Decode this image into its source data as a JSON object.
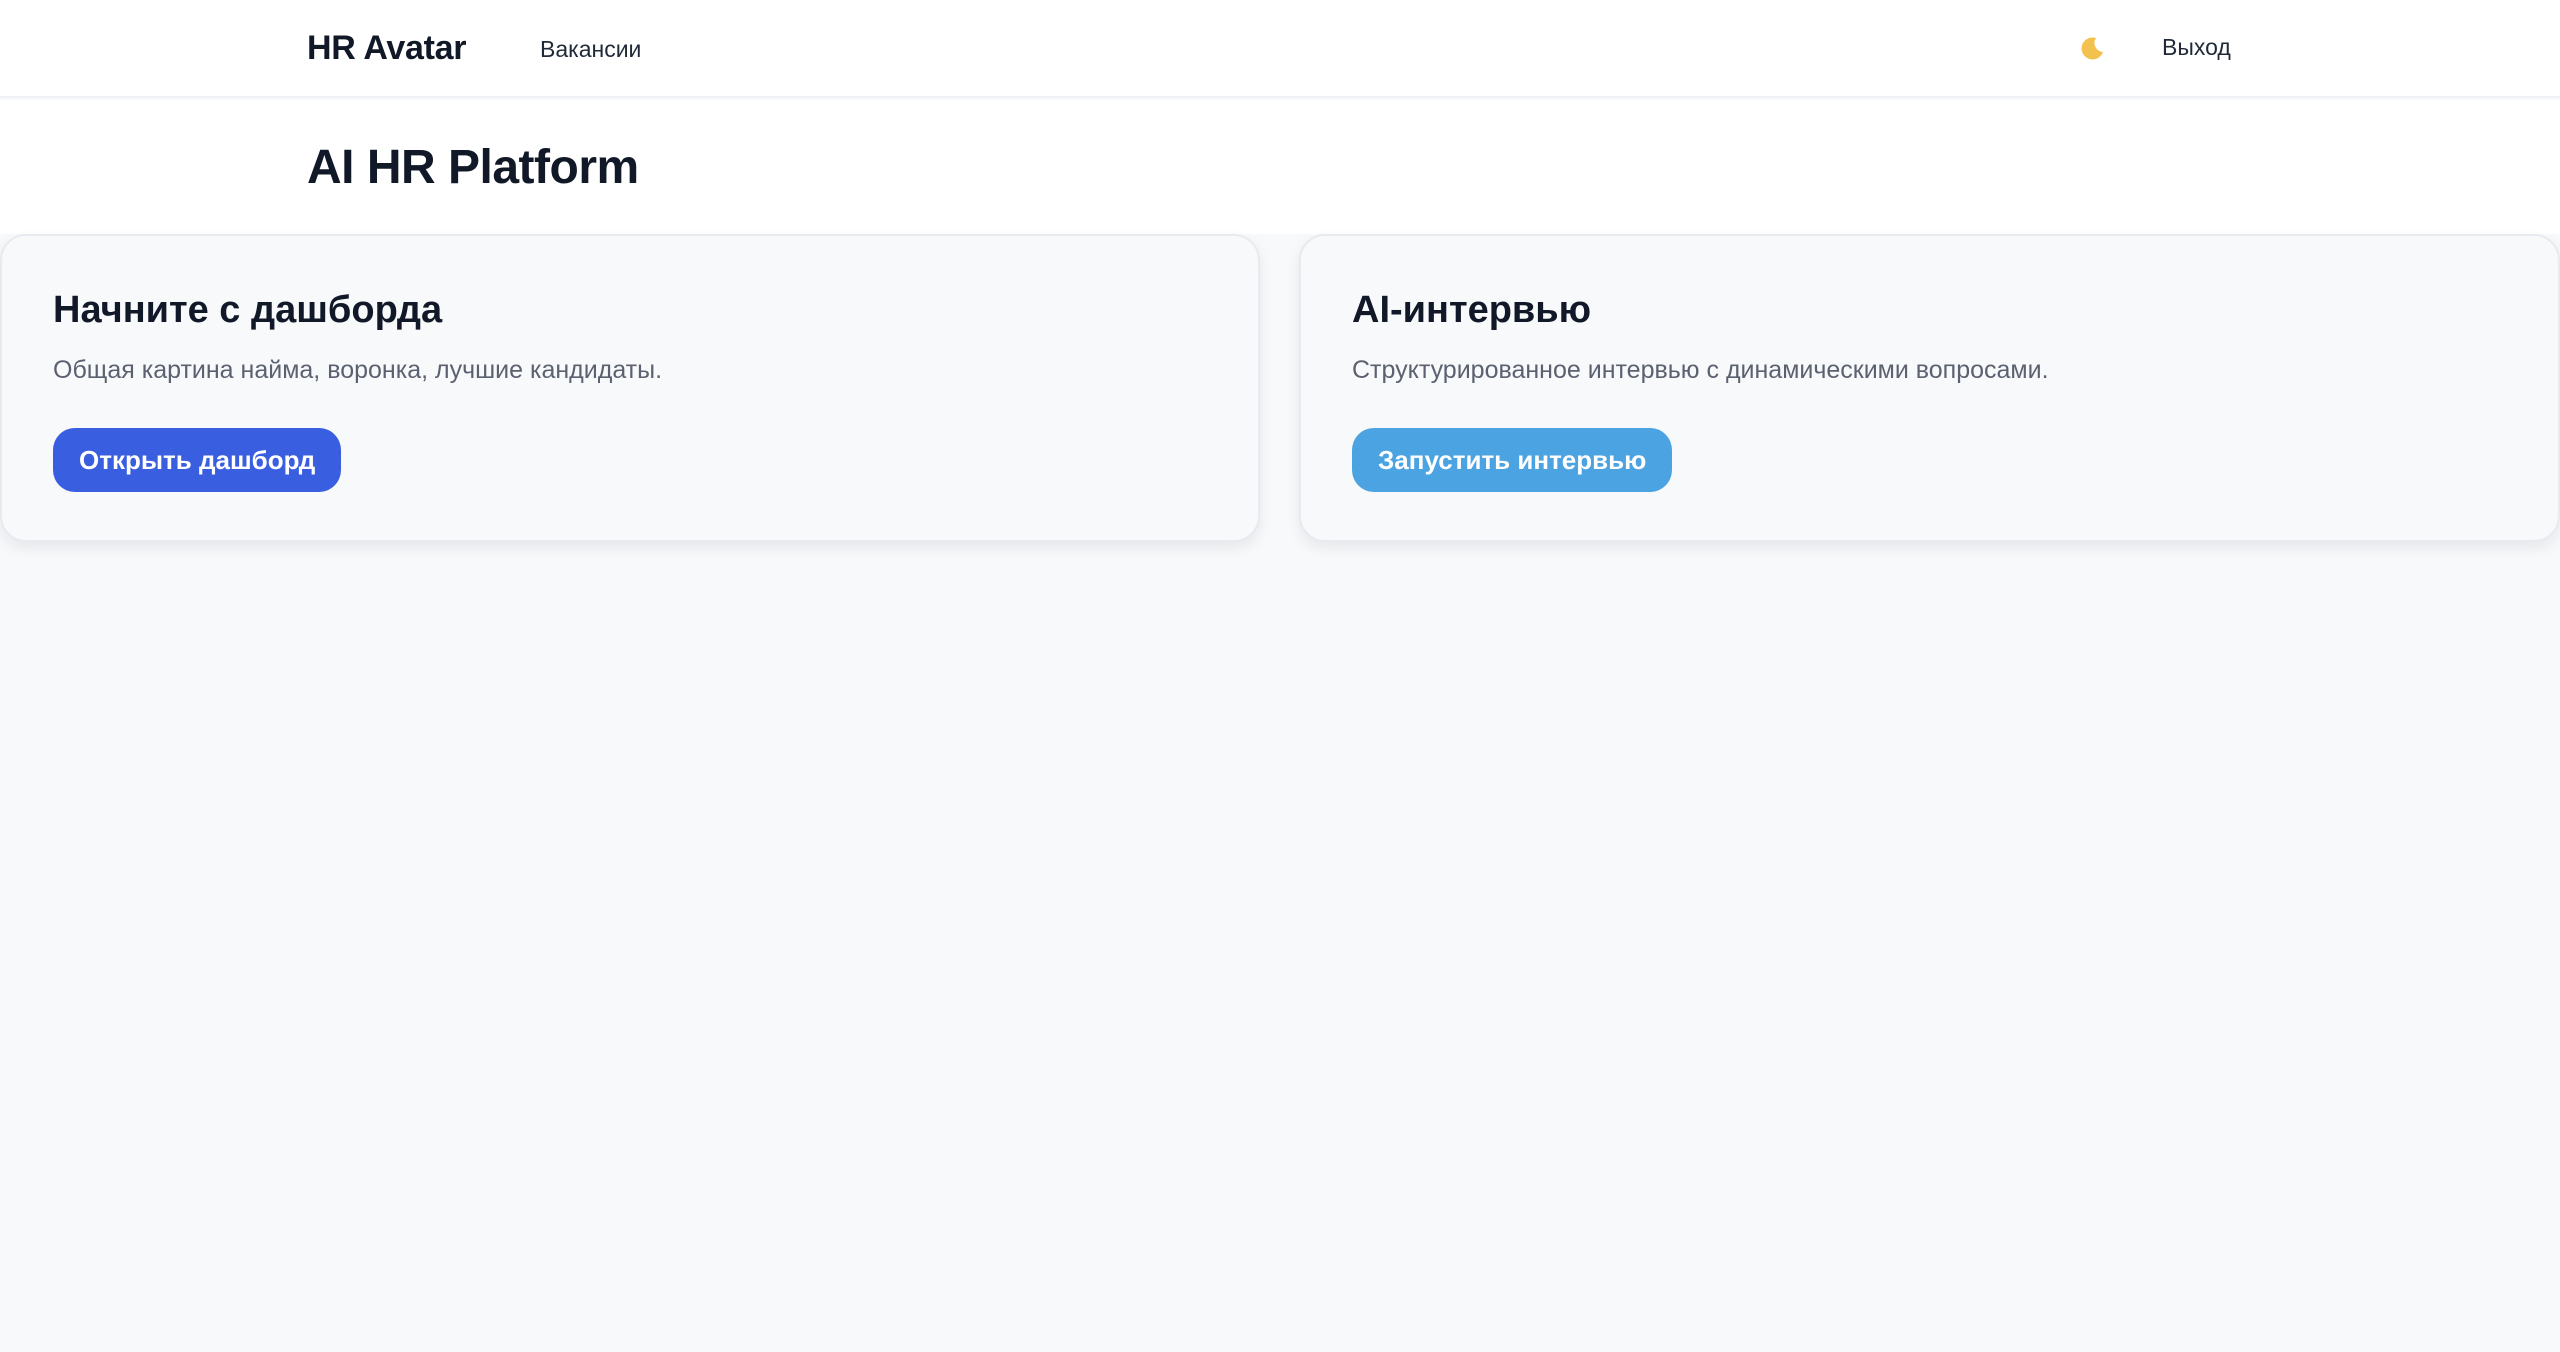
{
  "header": {
    "brand": "HR Avatar",
    "nav": {
      "vacancies_label": "Вакансии"
    },
    "theme_toggle_icon": "moon-icon",
    "logout_label": "Выход"
  },
  "page": {
    "title": "AI HR Platform"
  },
  "cards": [
    {
      "title": "Начните с дашборда",
      "description": "Общая картина найма, воронка, лучшие кандидаты.",
      "button_label": "Открыть дашборд",
      "button_color": "#3a5ee0"
    },
    {
      "title": "AI-интервью",
      "description": "Структурированное интервью с динамическими вопросами.",
      "button_label": "Запустить интервью",
      "button_color": "#4ba3e2"
    }
  ],
  "colors": {
    "background": "#f8f9fb",
    "surface": "#ffffff",
    "text_primary": "#111827",
    "text_secondary": "#5b6170",
    "moon": "#f2c14e"
  }
}
